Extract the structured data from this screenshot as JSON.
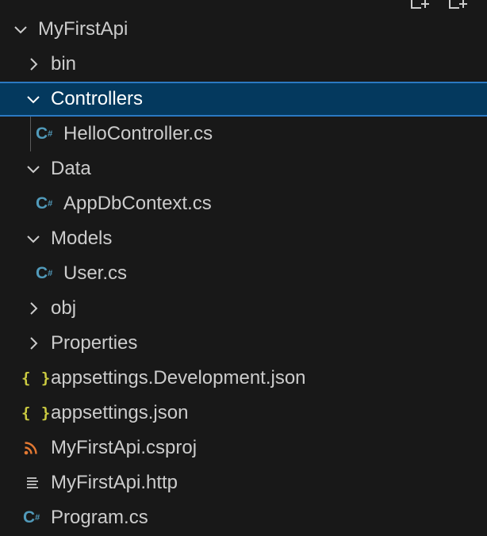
{
  "explorer": {
    "project": {
      "label": "MyFirstApi",
      "expanded": true
    },
    "items": [
      {
        "label": "bin",
        "type": "folder",
        "expanded": false
      },
      {
        "label": "Controllers",
        "type": "folder",
        "expanded": true,
        "selected": true
      },
      {
        "label": "HelloController.cs",
        "type": "csharp-file"
      },
      {
        "label": "Data",
        "type": "folder",
        "expanded": true
      },
      {
        "label": "AppDbContext.cs",
        "type": "csharp-file"
      },
      {
        "label": "Models",
        "type": "folder",
        "expanded": true
      },
      {
        "label": "User.cs",
        "type": "csharp-file"
      },
      {
        "label": "obj",
        "type": "folder",
        "expanded": false
      },
      {
        "label": "Properties",
        "type": "folder",
        "expanded": false
      },
      {
        "label": "appsettings.Development.json",
        "type": "json-file"
      },
      {
        "label": "appsettings.json",
        "type": "json-file"
      },
      {
        "label": "MyFirstApi.csproj",
        "type": "rss-file"
      },
      {
        "label": "MyFirstApi.http",
        "type": "text-file"
      },
      {
        "label": "Program.cs",
        "type": "csharp-file"
      }
    ]
  },
  "icons": {
    "csharp_glyph": "C",
    "csharp_sup": "#",
    "json_glyph": "{ }"
  },
  "colors": {
    "background": "#181818",
    "text": "#cccccc",
    "selection_background": "#04395e",
    "selection_border": "#2b79c2",
    "csharp_icon": "#519aba",
    "json_icon": "#cbcb41",
    "rss_icon": "#e37933"
  }
}
